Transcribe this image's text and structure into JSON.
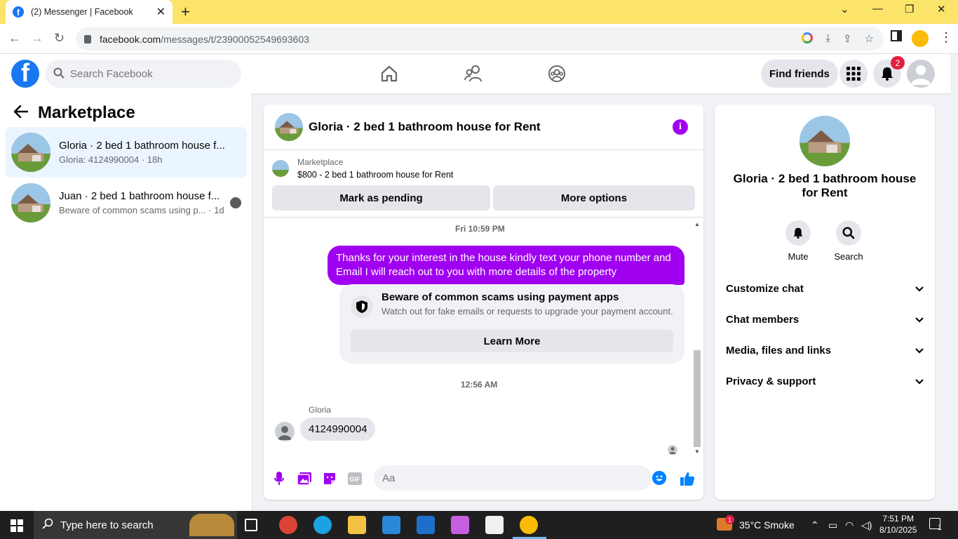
{
  "browser": {
    "tab_title": "(2) Messenger | Facebook",
    "url_host": "facebook.com",
    "url_path": "/messages/t/23900052549693603"
  },
  "header": {
    "search_placeholder": "Search Facebook",
    "find_friends": "Find friends",
    "notification_count": "2"
  },
  "sidebar": {
    "title": "Marketplace",
    "conversations": [
      {
        "name": "Gloria · 2 bed 1 bathroom house f...",
        "snippet": "Gloria: 4124990004 · 18h"
      },
      {
        "name": "Juan · 2 bed 1 bathroom house f...",
        "snippet": "Beware of common scams using p...  · 1d"
      }
    ]
  },
  "chat": {
    "title": "Gloria · 2 bed 1 bathroom house for Rent",
    "marketplace_label": "Marketplace",
    "listing": "$800 - 2 bed 1 bathroom house for Rent",
    "mark_pending": "Mark as pending",
    "more_options": "More options",
    "timestamp1": "Fri 10:59 PM",
    "outgoing_message": "Thanks for your interest in the house kindly text your phone number and Email I will reach out to you with more details of the property",
    "scam_title": "Beware of common scams using payment apps",
    "scam_text": "Watch out for fake emails or requests to upgrade your payment account.",
    "learn_more": "Learn More",
    "timestamp2": "12:56 AM",
    "sender_name": "Gloria",
    "incoming_message": "4124990004",
    "input_placeholder": "Aa"
  },
  "info_panel": {
    "title": "Gloria · 2 bed 1 bathroom house for Rent",
    "mute": "Mute",
    "search": "Search",
    "items": [
      "Customize chat",
      "Chat members",
      "Media, files and links",
      "Privacy & support"
    ]
  },
  "taskbar": {
    "search_placeholder": "Type here to search",
    "weather": "35°C  Smoke",
    "time": "7:51 PM",
    "date": "8/10/2025",
    "weather_badge": "1",
    "notification_count": "1"
  },
  "colors": {
    "accent": "#a000f0",
    "facebook_blue": "#1877f2",
    "tab_strip": "#fce46a"
  }
}
